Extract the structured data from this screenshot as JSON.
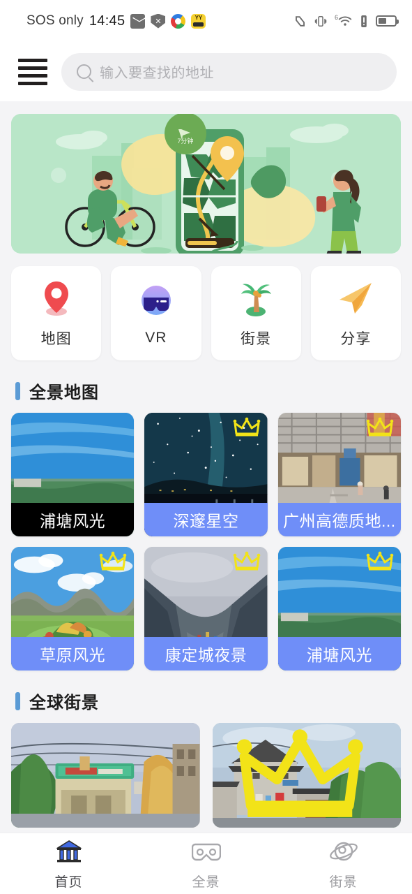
{
  "status_bar": {
    "carrier": "SOS only",
    "time": "14:45",
    "left_icons": [
      "mail-icon",
      "shield-block-icon",
      "color-app-icon",
      "yy-app-icon"
    ],
    "right_icons": [
      "nfc-icon",
      "vibrate-icon",
      "wifi-6-icon",
      "alert-icon",
      "battery-icon"
    ],
    "wifi_generation": "6",
    "battery_level": "44"
  },
  "header": {
    "menu_icon": "hamburger-menu-icon",
    "search": {
      "placeholder": "输入要查找的地址",
      "value": "",
      "icon": "search-icon"
    }
  },
  "banner": {
    "name": "navigation-illustration-banner",
    "badge_text": "7分钟",
    "bg_color": "#b7e5c6"
  },
  "quick_actions": [
    {
      "label": "地图",
      "icon": "map-pin-icon"
    },
    {
      "label": "VR",
      "icon": "vr-goggles-icon"
    },
    {
      "label": "街景",
      "icon": "palm-tree-icon"
    },
    {
      "label": "分享",
      "icon": "paper-plane-icon"
    }
  ],
  "sections": [
    {
      "title": "全景地图",
      "accent_color": "#5b9bd5"
    },
    {
      "title": "全球街景",
      "accent_color": "#5b9bd5"
    }
  ],
  "panoramas": [
    {
      "title": "浦塘风光",
      "crown": false,
      "caption_style": "dark",
      "scene": "aerial-city-green"
    },
    {
      "title": "深邃星空",
      "crown": true,
      "caption_style": "blue",
      "scene": "starry-night"
    },
    {
      "title": "广州高德质地...",
      "crown": true,
      "caption_style": "blue",
      "scene": "mall-interior"
    },
    {
      "title": "草原风光",
      "crown": true,
      "caption_style": "blue",
      "scene": "grassland-sculpture"
    },
    {
      "title": "康定城夜景",
      "crown": true,
      "caption_style": "blue",
      "scene": "mountain-valley"
    },
    {
      "title": "浦塘风光",
      "crown": true,
      "caption_style": "blue",
      "scene": "aerial-city-green"
    }
  ],
  "street_views": [
    {
      "crown": false,
      "scene": "green-shop-street"
    },
    {
      "crown": true,
      "scene": "old-town-roofs"
    }
  ],
  "tabbar": [
    {
      "label": "首页",
      "icon": "bank-home-icon",
      "active": true
    },
    {
      "label": "全景",
      "icon": "vr-goggles-icon",
      "active": false
    },
    {
      "label": "街景",
      "icon": "planet-icon",
      "active": false
    }
  ],
  "colors": {
    "page_bg": "#f4f4f6",
    "accent_blue": "#5b9bd5",
    "caption_blue": "#6f8ef8",
    "crown_yellow": "#f2e318",
    "active_tab": "#4169e1"
  }
}
